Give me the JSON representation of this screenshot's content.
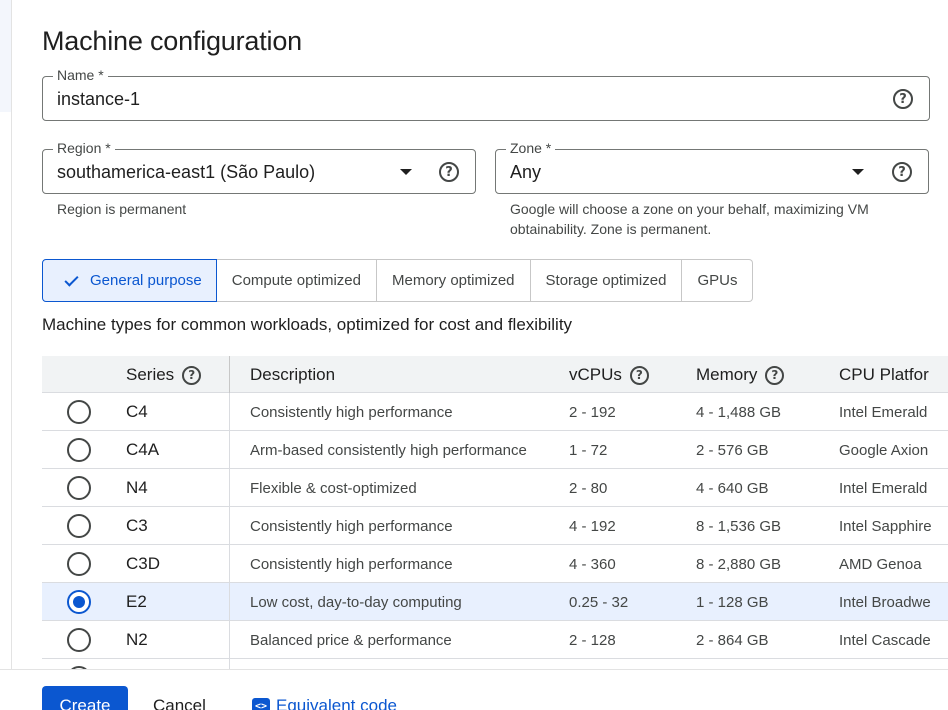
{
  "page": {
    "title": "Machine configuration"
  },
  "name_field": {
    "label": "Name *",
    "value": "instance-1",
    "help_icon": "help-circle-icon"
  },
  "region_field": {
    "label": "Region *",
    "value": "southamerica-east1 (São Paulo)",
    "hint": "Region is permanent"
  },
  "zone_field": {
    "label": "Zone *",
    "value": "Any",
    "hint_line1": "Google will choose a zone on your behalf, maximizing VM",
    "hint_line2": "obtainability. Zone is permanent."
  },
  "tabs": [
    {
      "label": "General purpose",
      "selected": true
    },
    {
      "label": "Compute optimized",
      "selected": false
    },
    {
      "label": "Memory optimized",
      "selected": false
    },
    {
      "label": "Storage optimized",
      "selected": false
    },
    {
      "label": "GPUs",
      "selected": false
    }
  ],
  "subtitle": "Machine types for common workloads, optimized for cost and flexibility",
  "table": {
    "headers": {
      "series": "Series",
      "description": "Description",
      "vcpus": "vCPUs",
      "memory": "Memory",
      "cpu_platform": "CPU Platfor"
    },
    "rows": [
      {
        "series": "C4",
        "description": "Consistently high performance",
        "vcpus": "2 - 192",
        "memory": "4 - 1,488 GB",
        "platform": "Intel Emerald",
        "selected": false
      },
      {
        "series": "C4A",
        "description": "Arm-based consistently high performance",
        "vcpus": "1 - 72",
        "memory": "2 - 576 GB",
        "platform": "Google Axion",
        "selected": false
      },
      {
        "series": "N4",
        "description": "Flexible & cost-optimized",
        "vcpus": "2 - 80",
        "memory": "4 - 640 GB",
        "platform": "Intel Emerald",
        "selected": false
      },
      {
        "series": "C3",
        "description": "Consistently high performance",
        "vcpus": "4 - 192",
        "memory": "8 - 1,536 GB",
        "platform": "Intel Sapphire",
        "selected": false
      },
      {
        "series": "C3D",
        "description": "Consistently high performance",
        "vcpus": "4 - 360",
        "memory": "8 - 2,880 GB",
        "platform": "AMD Genoa",
        "selected": false
      },
      {
        "series": "E2",
        "description": "Low cost, day-to-day computing",
        "vcpus": "0.25 - 32",
        "memory": "1 - 128 GB",
        "platform": "Intel Broadwe",
        "selected": true
      },
      {
        "series": "N2",
        "description": "Balanced price & performance",
        "vcpus": "2 - 128",
        "memory": "2 - 864 GB",
        "platform": "Intel Cascade",
        "selected": false
      }
    ]
  },
  "footer": {
    "create": "Create",
    "cancel": "Cancel",
    "equivalent_code": "Equivalent code"
  },
  "colors": {
    "accent": "#0b57d0",
    "selected_bg": "#e8f0fe"
  }
}
